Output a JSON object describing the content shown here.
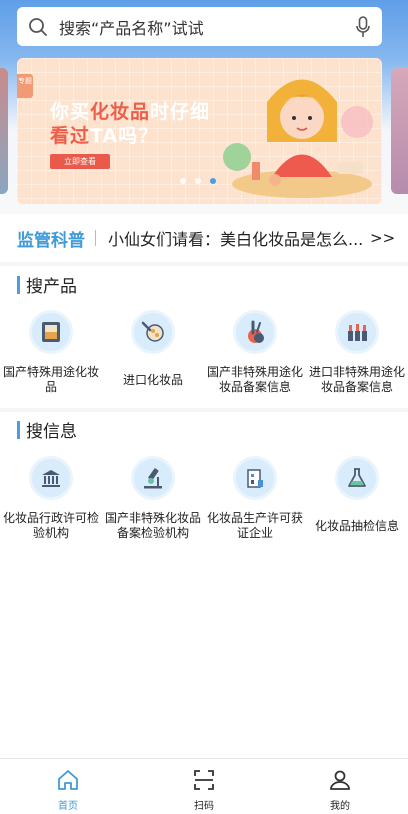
{
  "search": {
    "placeholder": "搜索“产品名称”试试"
  },
  "banner": {
    "tag": "专题",
    "line1_a": "你买",
    "line1_hl": "化妆品",
    "line1_b": "时仔细",
    "line2_hl": "看过",
    "line2_b": "TA吗？",
    "cta": "立即查看",
    "slide_count": 3,
    "active_slide": 3
  },
  "notice": {
    "title": "监管科普",
    "text": "小仙女们请看：美白化妆品是怎么...",
    "more": ">>"
  },
  "products": {
    "title": "搜产品",
    "items": [
      {
        "label": "国产特殊用途化妆品",
        "icon": "cosmetic-palette-icon"
      },
      {
        "label": "进口化妆品",
        "icon": "makeup-brushes-icon"
      },
      {
        "label": "国产非特殊用途化妆品备案信息",
        "icon": "brush-palette-icon"
      },
      {
        "label": "进口非特殊用途化妆品备案信息",
        "icon": "lipsticks-icon"
      }
    ]
  },
  "info": {
    "title": "搜信息",
    "items": [
      {
        "label": "化妆品行政许可检验机构",
        "icon": "government-building-icon"
      },
      {
        "label": "国产非特殊化妆品备案检验机构",
        "icon": "microscope-icon"
      },
      {
        "label": "化妆品生产许可获证企业",
        "icon": "factory-icon"
      },
      {
        "label": "化妆品抽检信息",
        "icon": "flask-icon"
      }
    ]
  },
  "tabbar": {
    "home": "首页",
    "scan": "扫码",
    "mine": "我的"
  },
  "colors": {
    "accent": "#3f9ad8",
    "header": "#5f9ee7",
    "icon_bg": "#d8ecfb"
  }
}
